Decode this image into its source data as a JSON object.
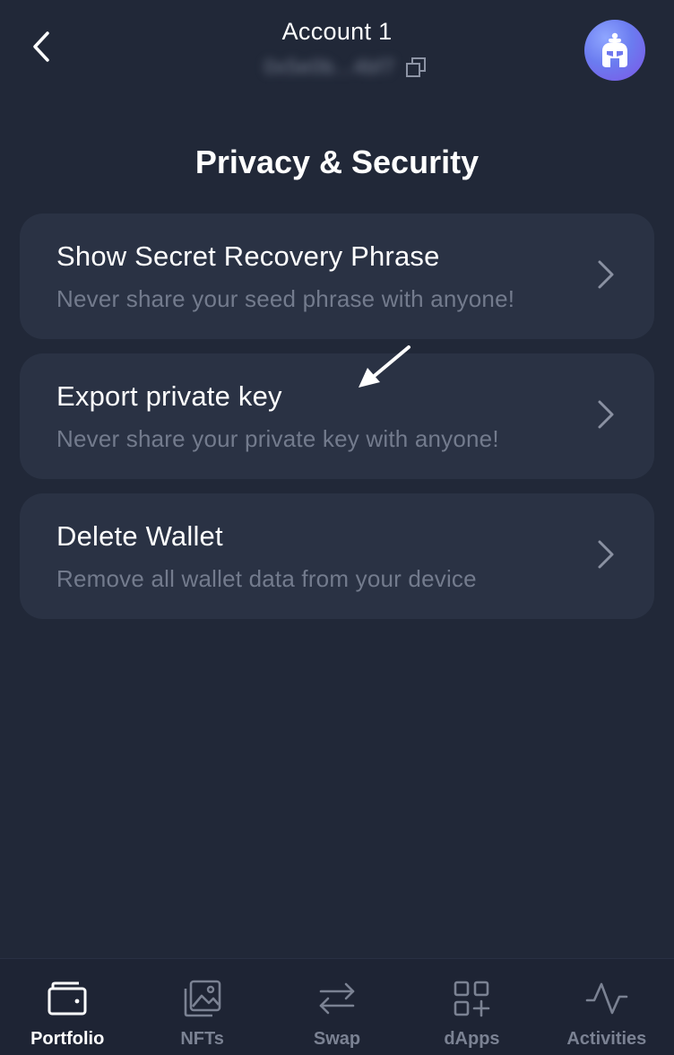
{
  "header": {
    "account_name": "Account 1",
    "address_masked": "0x5e0b...4bf7"
  },
  "page": {
    "title": "Privacy & Security"
  },
  "options": [
    {
      "title": "Show Secret Recovery Phrase",
      "subtitle": "Never share your seed phrase with anyone!"
    },
    {
      "title": "Export private key",
      "subtitle": "Never share your private key with anyone!"
    },
    {
      "title": "Delete Wallet",
      "subtitle": "Remove all wallet data from your device"
    }
  ],
  "nav": {
    "items": [
      {
        "label": "Portfolio",
        "icon": "wallet-icon",
        "active": true
      },
      {
        "label": "NFTs",
        "icon": "image-icon",
        "active": false
      },
      {
        "label": "Swap",
        "icon": "swap-icon",
        "active": false
      },
      {
        "label": "dApps",
        "icon": "apps-grid-icon",
        "active": false
      },
      {
        "label": "Activities",
        "icon": "activity-icon",
        "active": false
      }
    ]
  },
  "colors": {
    "background": "#212838",
    "card": "#2a3244",
    "muted_text": "#737b8d",
    "avatar_gradient_start": "#8fa6ff",
    "avatar_gradient_end": "#7d55e6"
  }
}
